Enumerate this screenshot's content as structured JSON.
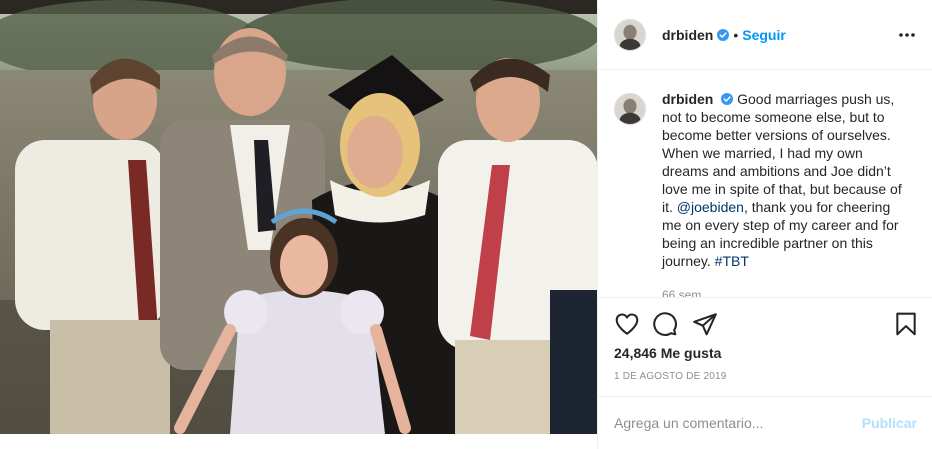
{
  "header": {
    "username": "drbiden",
    "separator": "•",
    "follow_label": "Seguir"
  },
  "caption": {
    "username": "drbiden",
    "text_part1": " Good marriages push us, not to become someone else, but to become better versions of ourselves. When we married, I had my own dreams and ambitions and Joe didn’t love me in spite of that, but because of it. ",
    "mention": "@joebiden",
    "text_part2": ", thank you for cheering me on every step of my career and for being an incredible partner on this journey. ",
    "hashtag": "#TBT",
    "time_ago": "66 sem"
  },
  "actions": {
    "icons": [
      "heart-icon",
      "comment-icon",
      "share-icon",
      "bookmark-icon"
    ]
  },
  "stats": {
    "likes": "24,846 Me gusta",
    "date": "1 DE AGOSTO DE 2019"
  },
  "comment": {
    "placeholder": "Agrega un comentario...",
    "post_label": "Publicar"
  },
  "colors": {
    "follow": "#0095f6",
    "verified": "#3897f0",
    "post_disabled": "#b2dffc",
    "link": "#00376b"
  }
}
